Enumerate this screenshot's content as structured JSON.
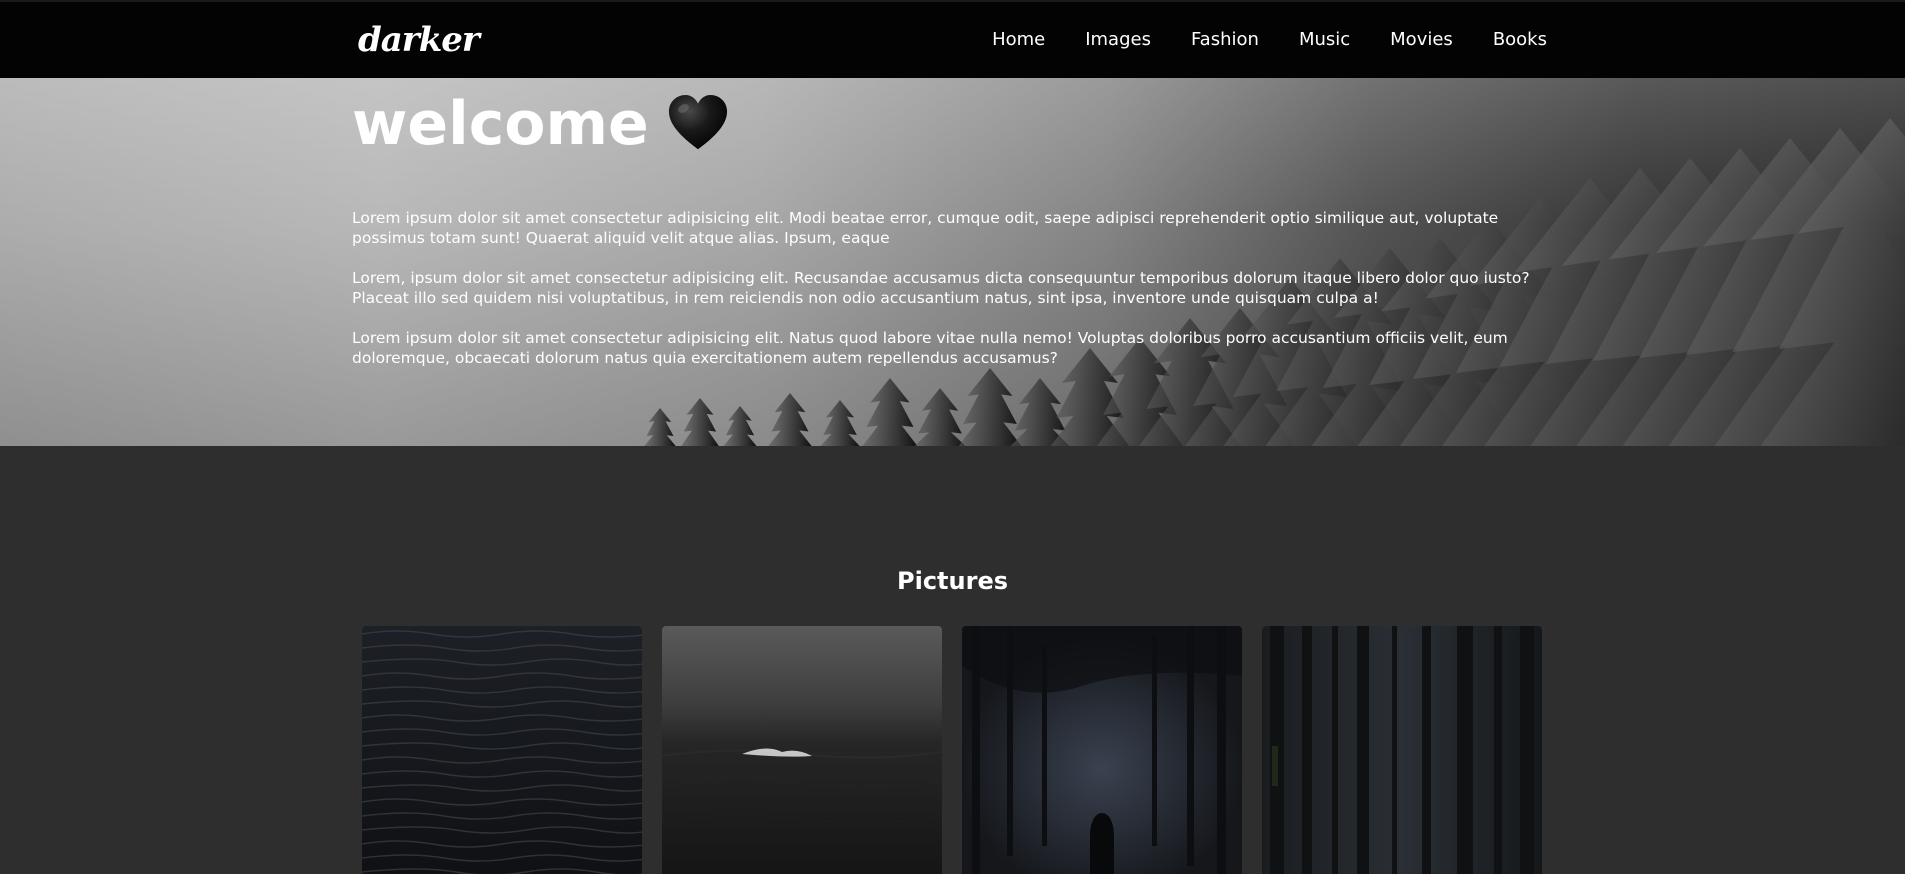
{
  "navbar": {
    "logo": "darker",
    "links": [
      {
        "label": "Home"
      },
      {
        "label": "Images"
      },
      {
        "label": "Fashion"
      },
      {
        "label": "Music"
      },
      {
        "label": "Movies"
      },
      {
        "label": "Books"
      }
    ]
  },
  "hero": {
    "title": "welcome",
    "title_icon": "black-heart-icon",
    "paragraphs": [
      "Lorem ipsum dolor sit amet consectetur adipisicing elit. Modi beatae error, cumque odit, saepe adipisci reprehenderit optio similique aut, voluptate possimus totam sunt! Quaerat aliquid velit atque alias. Ipsum, eaque",
      "Lorem, ipsum dolor sit amet consectetur adipisicing elit. Recusandae accusamus dicta consequuntur temporibus dolorum itaque libero dolor quo iusto? Placeat illo sed quidem nisi voluptatibus, in rem reiciendis non odio accusantium natus, sint ipsa, inventore unde quisquam culpa a!",
      "Lorem ipsum dolor sit amet consectetur adipisicing elit. Natus quod labore vitae nulla nemo! Voluptas doloribus porro accusantium officiis velit, eum doloremque, obcaecati dolorum natus quia exercitationem autem repellendus accusamus?"
    ]
  },
  "pictures": {
    "title": "Pictures",
    "images": [
      {
        "subject": "dark-ocean-waves"
      },
      {
        "subject": "foggy-sea-wave"
      },
      {
        "subject": "hooded-figure-in-dark-forest"
      },
      {
        "subject": "dark-pine-forest"
      }
    ]
  },
  "colors": {
    "navbar_bg": "#030303",
    "page_bg": "#2e2e2e",
    "text": "#ffffff"
  }
}
